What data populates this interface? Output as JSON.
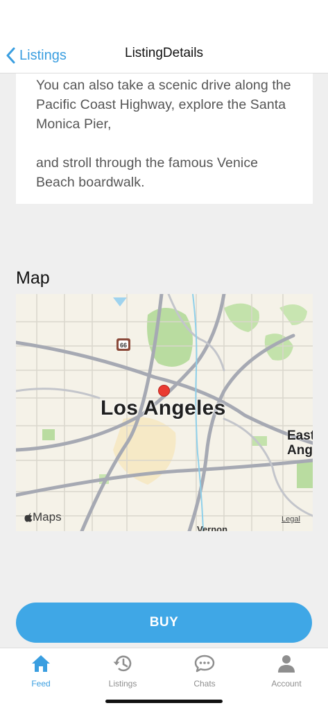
{
  "header": {
    "back_label": "Listings",
    "title": "ListingDetails"
  },
  "description": {
    "paragraph_1": "You can also take a scenic drive along the Pacific Coast Highway, explore the Santa Monica Pier,",
    "paragraph_2": "and stroll through the famous Venice Beach boardwalk."
  },
  "map": {
    "heading": "Map",
    "city_label": "Los Angeles",
    "east_label_line1": "East",
    "east_label_line2": "Ang",
    "south_label": "Vernon",
    "route_shield": "66",
    "brand": "Maps",
    "legal": "Legal"
  },
  "buy_button": {
    "label": "BUY"
  },
  "tabs": [
    {
      "label": "Feed",
      "icon": "home-icon",
      "active": true
    },
    {
      "label": "Listings",
      "icon": "history-icon",
      "active": false
    },
    {
      "label": "Chats",
      "icon": "chat-bubble-icon",
      "active": false
    },
    {
      "label": "Account",
      "icon": "person-icon",
      "active": false
    }
  ],
  "colors": {
    "accent": "#3a9ee0",
    "button": "#3fa7e6",
    "background": "#efefef",
    "pin": "#ea3b32"
  }
}
